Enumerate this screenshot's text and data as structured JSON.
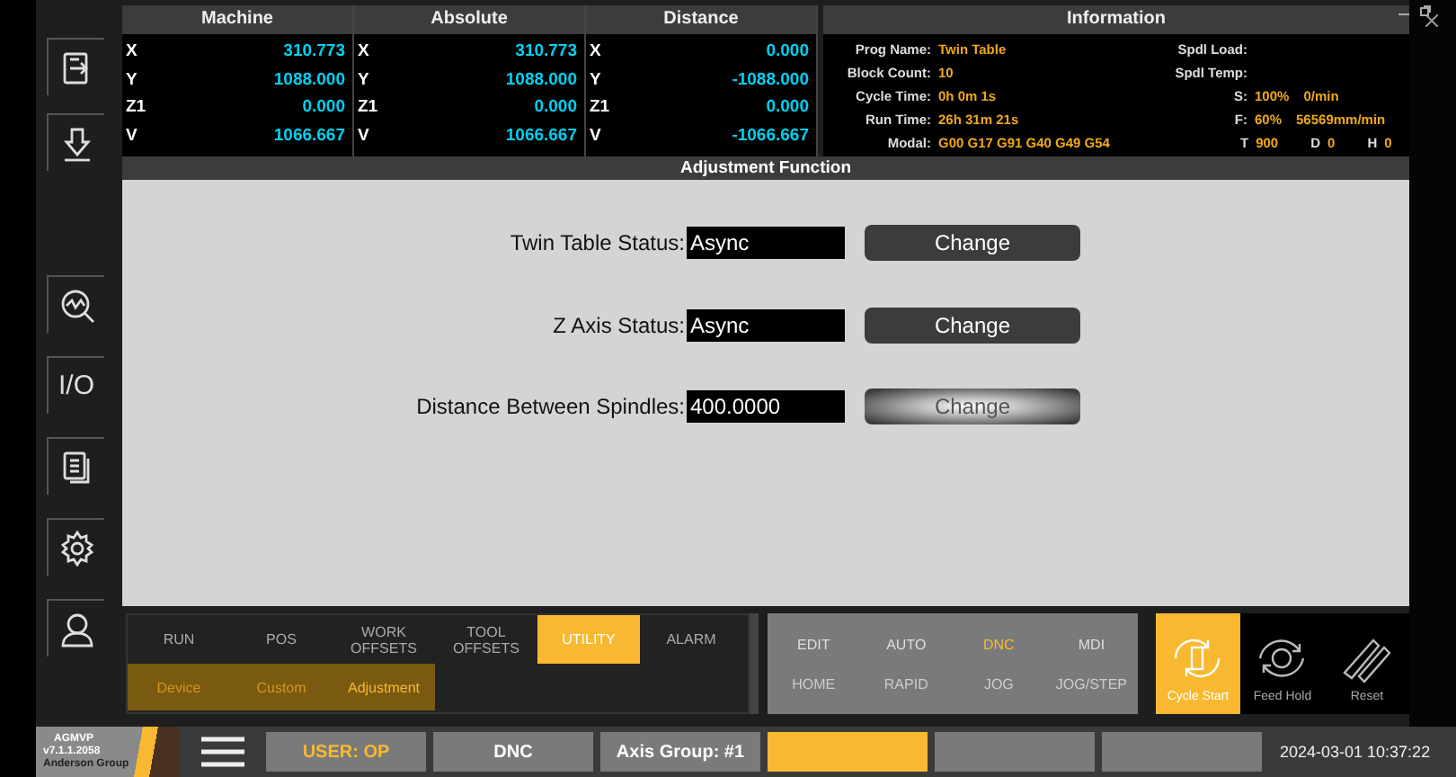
{
  "sidebar": [
    {
      "kind": "export"
    },
    {
      "kind": "download"
    },
    {
      "kind": "diagnostics"
    },
    {
      "kind": "text",
      "label": "I/O"
    },
    {
      "kind": "documents"
    },
    {
      "kind": "settings"
    },
    {
      "kind": "user"
    }
  ],
  "positions": [
    {
      "title": "Machine",
      "rows": [
        {
          "axis": "X",
          "value": "310.773"
        },
        {
          "axis": "Y",
          "value": "1088.000"
        },
        {
          "axis": "Z1",
          "value": "0.000"
        },
        {
          "axis": "V",
          "value": "1066.667"
        }
      ]
    },
    {
      "title": "Absolute",
      "rows": [
        {
          "axis": "X",
          "value": "310.773"
        },
        {
          "axis": "Y",
          "value": "1088.000"
        },
        {
          "axis": "Z1",
          "value": "0.000"
        },
        {
          "axis": "V",
          "value": "1066.667"
        }
      ]
    },
    {
      "title": "Distance",
      "rows": [
        {
          "axis": "X",
          "value": "0.000"
        },
        {
          "axis": "Y",
          "value": "-1088.000"
        },
        {
          "axis": "Z1",
          "value": "0.000"
        },
        {
          "axis": "V",
          "value": "-1066.667"
        }
      ]
    }
  ],
  "information": {
    "title": "Information",
    "left": [
      {
        "label": "Prog Name:",
        "value": "Twin Table"
      },
      {
        "label": "Block Count:",
        "value": "10"
      },
      {
        "label": "Cycle Time:",
        "value": "0h 0m 1s"
      },
      {
        "label": "Run Time:",
        "value": "26h 31m 21s"
      },
      {
        "label": "Modal:",
        "value": "G00 G17 G91 G40 G49 G54"
      }
    ],
    "right": [
      {
        "label": "Spdl Load:"
      },
      {
        "label": "Spdl Temp:"
      },
      {
        "label": "S:",
        "values": [
          "100%",
          "0/min"
        ]
      },
      {
        "label": "F:",
        "values": [
          "60%",
          "56569mm/min"
        ]
      }
    ],
    "tool": [
      {
        "label": "T",
        "value": "900"
      },
      {
        "label": "D",
        "value": "0"
      },
      {
        "label": "H",
        "value": "0"
      }
    ]
  },
  "adjustment": {
    "title": "Adjustment Function",
    "rows": [
      {
        "label": "Twin Table Status:",
        "value": "Async",
        "button": "Change",
        "hovered": false
      },
      {
        "label": "Z Axis Status:",
        "value": "Async",
        "button": "Change",
        "hovered": false
      },
      {
        "label": "Distance Between Spindles:",
        "value": "400.0000",
        "button": "Change",
        "hovered": true
      }
    ]
  },
  "tabs": [
    {
      "label": "RUN",
      "selected": false
    },
    {
      "label": "POS",
      "selected": false
    },
    {
      "label": "WORK OFFSETS",
      "selected": false
    },
    {
      "label": "TOOL OFFSETS",
      "selected": false
    },
    {
      "label": "UTILITY",
      "selected": true
    },
    {
      "label": "ALARM",
      "selected": false
    }
  ],
  "subtabs": [
    {
      "label": "Device",
      "selected": false
    },
    {
      "label": "Custom",
      "selected": false
    },
    {
      "label": "Adjustment",
      "selected": true
    }
  ],
  "modes": {
    "top": [
      {
        "label": "EDIT",
        "selected": false
      },
      {
        "label": "AUTO",
        "selected": false
      },
      {
        "label": "DNC",
        "selected": true
      },
      {
        "label": "MDI",
        "selected": false
      }
    ],
    "bottom": [
      {
        "label": "HOME",
        "selected": false
      },
      {
        "label": "RAPID",
        "selected": false
      },
      {
        "label": "JOG",
        "selected": false
      },
      {
        "label": "JOG/STEP",
        "selected": false
      }
    ]
  },
  "cycle_buttons": [
    {
      "kind": "start",
      "label": "Cycle Start",
      "active": true
    },
    {
      "kind": "hold",
      "label": "Feed Hold",
      "active": false
    },
    {
      "kind": "reset",
      "label": "Reset",
      "active": false
    }
  ],
  "status_bar": {
    "logo": {
      "name": "AGMVP",
      "version": "v7.1.1.2058",
      "company": "Anderson Group"
    },
    "fields": [
      {
        "text": "USER: OP",
        "kind": "user",
        "active": false
      },
      {
        "text": "DNC",
        "kind": "plain",
        "active": false
      },
      {
        "text": "Axis Group: #1",
        "kind": "plain",
        "active": false
      },
      {
        "kind": "plain",
        "active": true
      },
      {
        "kind": "plain",
        "active": false
      },
      {
        "kind": "plain",
        "active": false
      }
    ],
    "datetime": "2024-03-01 10:37:22"
  }
}
